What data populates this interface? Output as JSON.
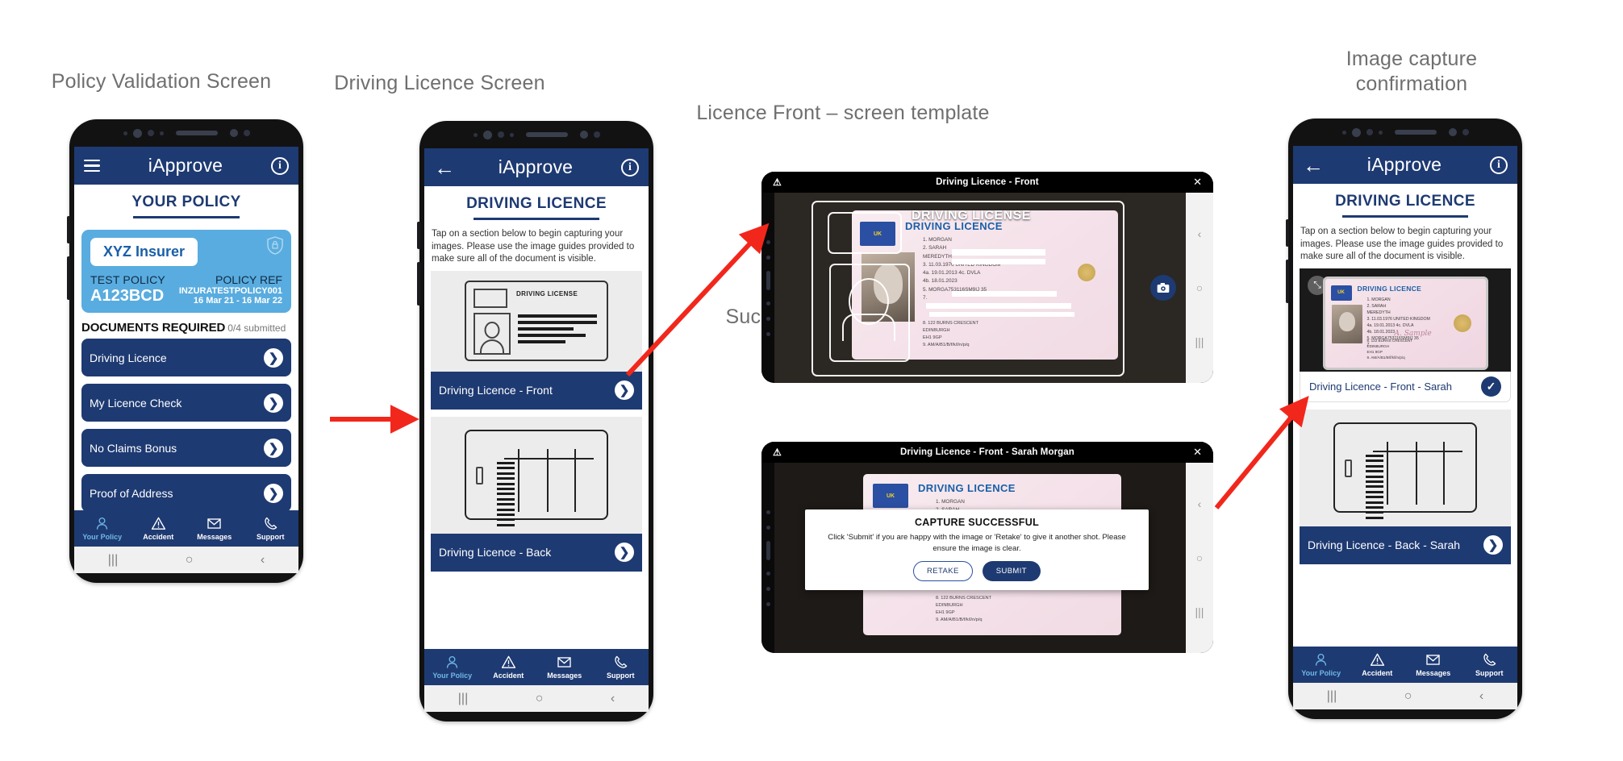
{
  "captions": {
    "policy_validation": "Policy Validation Screen",
    "driving_licence": "Driving Licence Screen",
    "licence_front_template": "Licence Front – screen template",
    "successful_capture": "Successful image capture",
    "image_capture_confirmation": "Image capture\nconfirmation"
  },
  "colors": {
    "brand_navy": "#1e3a72",
    "card_blue": "#59acdf",
    "accent_light_blue": "#6fb8e8",
    "arrow_red": "#f2271c",
    "panel_grey": "#ececec"
  },
  "app": {
    "title": "iApprove",
    "menu_icon": "hamburger-icon",
    "back_icon": "back-arrow-icon",
    "info_icon": "info-icon"
  },
  "phone1": {
    "section_title": "YOUR POLICY",
    "policy_card": {
      "insurer": "XYZ Insurer",
      "policy_label": "TEST POLICY",
      "policy_value": "A123BCD",
      "ref_label": "POLICY REF",
      "ref_value": "INZURATESTPOLICY001",
      "dates": "16 Mar 21 - 16 Mar 22",
      "badge_icon": "shield-lock-icon"
    },
    "documents_heading": "DOCUMENTS REQUIRED",
    "documents_submitted": "0/4 submitted",
    "documents": [
      {
        "label": "Driving Licence"
      },
      {
        "label": "My Licence Check"
      },
      {
        "label": "No Claims Bonus"
      },
      {
        "label": "Proof of Address"
      }
    ]
  },
  "phone2": {
    "section_title": "DRIVING LICENCE",
    "help_text": "Tap on a section below to begin capturing your images. Please use the image guides provided to make sure all of the document is visible.",
    "front_row_label": "Driving Licence - Front",
    "back_row_label": "Driving Licence - Back",
    "template_front_title": "DRIVING LICENSE"
  },
  "phone4": {
    "section_title": "DRIVING LICENCE",
    "help_text": "Tap on a section below to begin capturing your images. Please use the image guides provided to make sure all of the document is visible.",
    "captured_label": "Driving Licence - Front - Sarah",
    "captured_status_icon": "check-circle-icon",
    "expand_icon": "expand-icon",
    "back_row_label": "Driving Licence - Back - Sarah"
  },
  "tabs": [
    {
      "label": "Your Policy",
      "icon": "person-icon",
      "active": true
    },
    {
      "label": "Accident",
      "icon": "warning-triangle-icon",
      "active": false
    },
    {
      "label": "Messages",
      "icon": "envelope-icon",
      "active": false
    },
    {
      "label": "Support",
      "icon": "phone-icon",
      "active": false
    }
  ],
  "android_nav": {
    "recents": "|||",
    "home": "○",
    "back": "‹"
  },
  "camera_shot_1": {
    "title": "Driving Licence - Front",
    "flash_icon": "flash-off-icon",
    "close_icon": "close-icon",
    "capture_icon": "camera-icon"
  },
  "camera_shot_2": {
    "title": "Driving Licence - Front - Sarah Morgan",
    "flash_icon": "flash-off-icon",
    "close_icon": "close-icon",
    "dialog": {
      "title": "CAPTURE SUCCESSFUL",
      "body": "Click 'Submit' if you are happy with the image or 'Retake' to give it another shot. Please ensure the image is clear.",
      "retake": "RETAKE",
      "submit": "SUBMIT"
    }
  },
  "licence_content": {
    "heading_white": "DRIVING LICENSE",
    "heading_blue": "DRIVING LICENCE",
    "uk_badge": "UK",
    "fields": "1.   MORGAN\n2.   SARAH\n      MEREDYTH\n3.   11.03.1976  UNITED KINGDOM\n4a. 19.01.2013   4c.  DVLA\n4b. 18.01.2023\n5.        MORGA753116SM9IJ 35\n7.",
    "address": "8.   122 BURNS CRESCENT\n      EDINBURGH\n      EH1 9GP\n9.   AM/A/B1/B/f/k/l/n/p/q",
    "signature": "A. Sample"
  }
}
